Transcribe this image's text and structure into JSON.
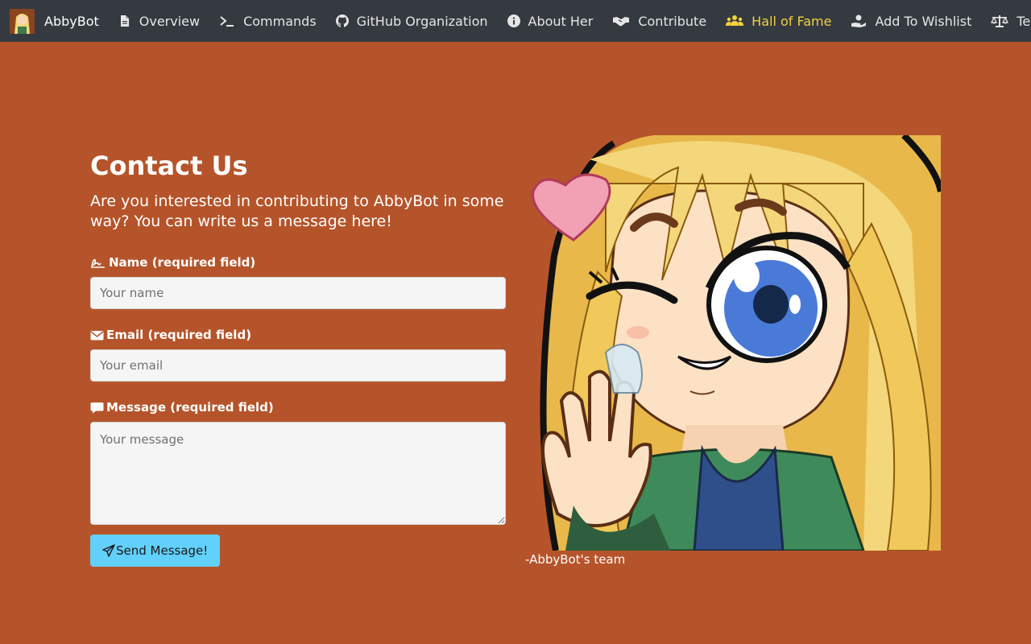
{
  "navbar": {
    "brand": "AbbyBot",
    "items": [
      {
        "label": "Overview",
        "icon": "file-icon"
      },
      {
        "label": "Commands",
        "icon": "terminal-icon"
      },
      {
        "label": "GitHub Organization",
        "icon": "github-icon"
      },
      {
        "label": "About Her",
        "icon": "info-icon"
      },
      {
        "label": "Contribute",
        "icon": "handshake-icon"
      },
      {
        "label": "Hall of Fame",
        "icon": "users-icon",
        "active": true
      },
      {
        "label": "Add To Wishlist",
        "icon": "hand-holding-icon"
      },
      {
        "label": "Terms And C",
        "icon": "scale-icon"
      }
    ],
    "active_color": "#f4d03f"
  },
  "contact": {
    "title": "Contact Us",
    "lead": "Are you interested in contributing to AbbyBot in some way? You can write us a message here!",
    "name_label": "Name (required field)",
    "name_placeholder": "Your name",
    "email_label": "Email (required field)",
    "email_placeholder": "Your email",
    "message_label": "Message (required field)",
    "message_placeholder": "Your message",
    "send_label": "Send Message!"
  },
  "illustration": {
    "caption": "-AbbyBot's team"
  },
  "colors": {
    "background": "#b5542a",
    "navbar": "#343a40",
    "button": "#61d0fa"
  }
}
